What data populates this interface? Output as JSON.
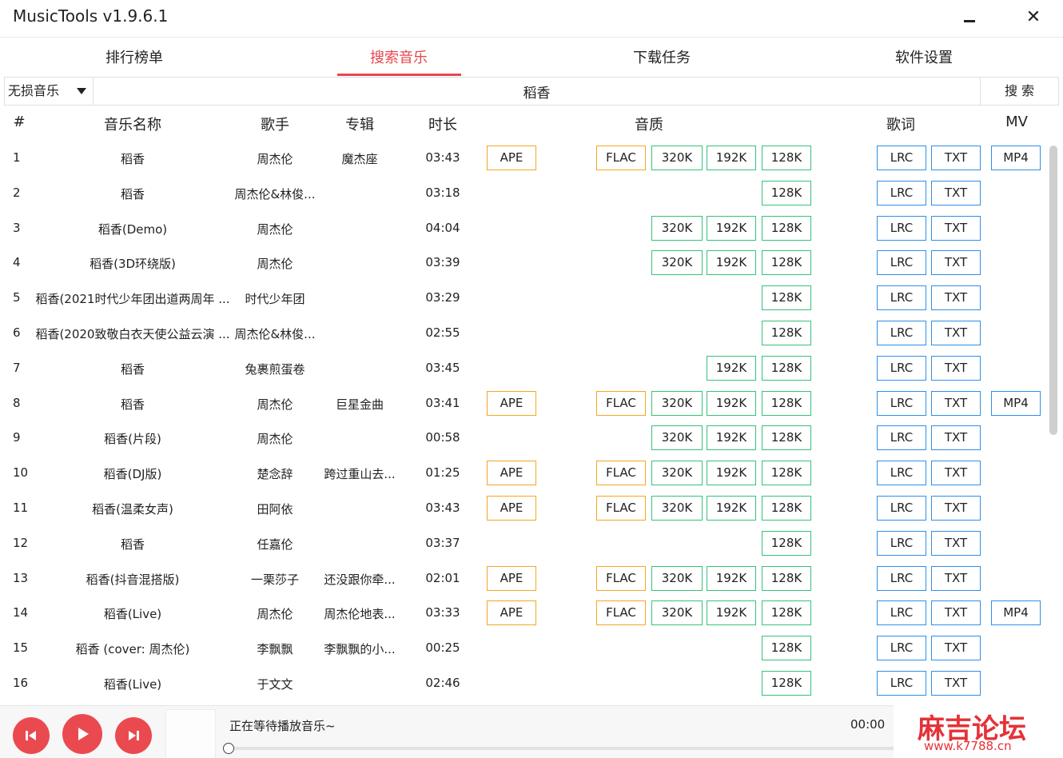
{
  "window": {
    "title": "MusicTools v1.9.6.1",
    "minimize_glyph": "",
    "close_glyph": "✕"
  },
  "tabs": [
    {
      "label": "排行榜单"
    },
    {
      "label": "搜索音乐"
    },
    {
      "label": "下载任务"
    },
    {
      "label": "软件设置"
    }
  ],
  "active_tab": 1,
  "search": {
    "source": "无损音乐",
    "query": "稻香",
    "button": "搜 索"
  },
  "table": {
    "headers": {
      "num": "#",
      "name": "音乐名称",
      "artist": "歌手",
      "album": "专辑",
      "duration": "时长",
      "quality": "音质",
      "lyrics": "歌词",
      "mv": "MV"
    },
    "rows": [
      {
        "num": "1",
        "name": "稻香",
        "artist": "周杰伦",
        "album": "魔杰座",
        "duration": "03:43",
        "ape": "APE",
        "flac": "FLAC",
        "q320": "320K",
        "q192": "192K",
        "q128": "128K",
        "lrc": "LRC",
        "txt": "TXT",
        "mp4": "MP4"
      },
      {
        "num": "2",
        "name": "稻香",
        "artist": "周杰伦&林俊...",
        "album": "",
        "duration": "03:18",
        "q128": "128K",
        "lrc": "LRC",
        "txt": "TXT"
      },
      {
        "num": "3",
        "name": "稻香(Demo)",
        "artist": "周杰伦",
        "album": "",
        "duration": "04:04",
        "q320": "320K",
        "q192": "192K",
        "q128": "128K",
        "lrc": "LRC",
        "txt": "TXT"
      },
      {
        "num": "4",
        "name": "稻香(3D环绕版)",
        "artist": "周杰伦",
        "album": "",
        "duration": "03:39",
        "q320": "320K",
        "q192": "192K",
        "q128": "128K",
        "lrc": "LRC",
        "txt": "TXT"
      },
      {
        "num": "5",
        "name": "稻香(2021时代少年团出道两周年 ...",
        "artist": "时代少年团",
        "album": "",
        "duration": "03:29",
        "q128": "128K",
        "lrc": "LRC",
        "txt": "TXT"
      },
      {
        "num": "6",
        "name": "稻香(2020致敬白衣天使公益云演 ...",
        "artist": "周杰伦&林俊...",
        "album": "",
        "duration": "02:55",
        "q128": "128K",
        "lrc": "LRC",
        "txt": "TXT"
      },
      {
        "num": "7",
        "name": "稻香",
        "artist": "兔裹煎蛋卷",
        "album": "",
        "duration": "03:45",
        "q192": "192K",
        "q128": "128K",
        "lrc": "LRC",
        "txt": "TXT"
      },
      {
        "num": "8",
        "name": "稻香",
        "artist": "周杰伦",
        "album": "巨星金曲",
        "duration": "03:41",
        "ape": "APE",
        "flac": "FLAC",
        "q320": "320K",
        "q192": "192K",
        "q128": "128K",
        "lrc": "LRC",
        "txt": "TXT",
        "mp4": "MP4"
      },
      {
        "num": "9",
        "name": "稻香(片段)",
        "artist": "周杰伦",
        "album": "",
        "duration": "00:58",
        "q320": "320K",
        "q192": "192K",
        "q128": "128K",
        "lrc": "LRC",
        "txt": "TXT"
      },
      {
        "num": "10",
        "name": "稻香(DJ版)",
        "artist": "楚念辞",
        "album": "跨过重山去...",
        "duration": "01:25",
        "ape": "APE",
        "flac": "FLAC",
        "q320": "320K",
        "q192": "192K",
        "q128": "128K",
        "lrc": "LRC",
        "txt": "TXT"
      },
      {
        "num": "11",
        "name": "稻香(温柔女声)",
        "artist": "田阿依",
        "album": "",
        "duration": "03:43",
        "ape": "APE",
        "flac": "FLAC",
        "q320": "320K",
        "q192": "192K",
        "q128": "128K",
        "lrc": "LRC",
        "txt": "TXT"
      },
      {
        "num": "12",
        "name": "稻香",
        "artist": "任嘉伦",
        "album": "",
        "duration": "03:37",
        "q128": "128K",
        "lrc": "LRC",
        "txt": "TXT"
      },
      {
        "num": "13",
        "name": "稻香(抖音混搭版)",
        "artist": "一栗莎子",
        "album": "还没跟你牵...",
        "duration": "02:01",
        "ape": "APE",
        "flac": "FLAC",
        "q320": "320K",
        "q192": "192K",
        "q128": "128K",
        "lrc": "LRC",
        "txt": "TXT"
      },
      {
        "num": "14",
        "name": "稻香(Live)",
        "artist": "周杰伦",
        "album": "周杰伦地表...",
        "duration": "03:33",
        "ape": "APE",
        "flac": "FLAC",
        "q320": "320K",
        "q192": "192K",
        "q128": "128K",
        "lrc": "LRC",
        "txt": "TXT",
        "mp4": "MP4"
      },
      {
        "num": "15",
        "name": "稻香 (cover: 周杰伦)",
        "artist": "李飘飘",
        "album": "李飘飘的小...",
        "duration": "00:25",
        "q128": "128K",
        "lrc": "LRC",
        "txt": "TXT"
      },
      {
        "num": "16",
        "name": "稻香(Live)",
        "artist": "于文文",
        "album": "",
        "duration": "02:46",
        "q128": "128K",
        "lrc": "LRC",
        "txt": "TXT"
      }
    ]
  },
  "player": {
    "status": "正在等待播放音乐~",
    "time": "00:00",
    "progress": 0
  },
  "watermark": {
    "text": "麻吉论坛",
    "url": "www.k7788.cn"
  },
  "colors": {
    "accent": "#e8464d",
    "lossless_border": "#f5a623",
    "mp3_border": "#35c27a",
    "lyrics_border": "#2f8fe8",
    "player_button": "#ea4a4f"
  },
  "icons": {
    "prev": "skip-previous-icon",
    "play": "play-icon",
    "next": "skip-next-icon",
    "dropdown": "caret-down-icon",
    "close": "close-icon",
    "minimize": "minimize-icon"
  }
}
